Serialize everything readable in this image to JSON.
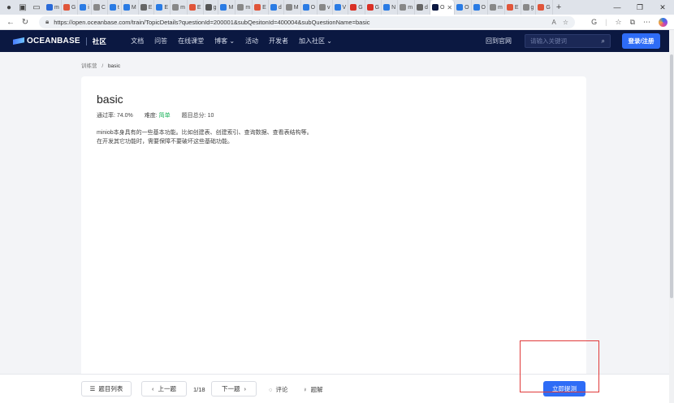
{
  "browser": {
    "tabs": [
      {
        "label": "m",
        "color": "#2a6ad8"
      },
      {
        "label": "G",
        "color": "#e0553a"
      },
      {
        "label": "i",
        "color": "#2a7be4"
      },
      {
        "label": "C",
        "color": "#888888"
      },
      {
        "label": "t",
        "color": "#2a7be4"
      },
      {
        "label": "M",
        "color": "#2a7be4"
      },
      {
        "label": "E",
        "color": "#666666"
      },
      {
        "label": "E",
        "color": "#2a7be4"
      },
      {
        "label": "m",
        "color": "#888888"
      },
      {
        "label": "E",
        "color": "#e0553a"
      },
      {
        "label": "g",
        "color": "#555555"
      },
      {
        "label": "M",
        "color": "#2a7be4"
      },
      {
        "label": "m",
        "color": "#888888"
      },
      {
        "label": "E",
        "color": "#e0553a"
      },
      {
        "label": "d",
        "color": "#2a7be4"
      },
      {
        "label": "M",
        "color": "#888888"
      },
      {
        "label": "O",
        "color": "#2a7be4"
      },
      {
        "label": "v",
        "color": "#888888"
      },
      {
        "label": "V",
        "color": "#2a7be4"
      },
      {
        "label": "G",
        "color": "#d93025"
      },
      {
        "label": "G",
        "color": "#d93025"
      },
      {
        "label": "N",
        "color": "#2a7be4"
      },
      {
        "label": "m",
        "color": "#888888"
      },
      {
        "label": "d",
        "color": "#666666"
      }
    ],
    "active_tab": {
      "label": "O",
      "color": "#0b1841"
    },
    "tabs_after": [
      {
        "label": "O",
        "color": "#2a7be4"
      },
      {
        "label": "O",
        "color": "#2a7be4"
      },
      {
        "label": "m",
        "color": "#888888"
      },
      {
        "label": "E",
        "color": "#e0553a"
      },
      {
        "label": "g",
        "color": "#888888"
      },
      {
        "label": "G",
        "color": "#e0553a"
      }
    ],
    "url": "https://open.oceanbase.com/train/TopicDetails?questionId=200001&subQesitonId=400004&subQuestionName=basic"
  },
  "header": {
    "logo_text": "OCEANBASE",
    "community": "社区",
    "nav": [
      "文档",
      "问答",
      "在线课堂",
      "博客",
      "活动",
      "开发者",
      "加入社区"
    ],
    "home_link": "回到官网",
    "search_placeholder": "请输入关键词",
    "login_label": "登录/注册"
  },
  "breadcrumb": {
    "parent": "训练营",
    "separator": "/",
    "current": "basic"
  },
  "problem": {
    "title": "basic",
    "pass_rate_label": "通过率:",
    "pass_rate": "74.0%",
    "difficulty_label": "难度:",
    "difficulty": "简单",
    "score_label": "题目总分:",
    "score": "10",
    "description_line1": "miniob本身具有的一些基本功能。比如创建表、创建索引、查询数据、查看表结构等。",
    "description_line2": "在开发其它功能时，需要保障不要破坏这些基础功能。"
  },
  "footer": {
    "list_label": "题目列表",
    "prev_label": "上一题",
    "page_indicator": "1/18",
    "next_label": "下一题",
    "comment_label": "评论",
    "solution_label": "题解",
    "submit_label": "立即提测"
  }
}
